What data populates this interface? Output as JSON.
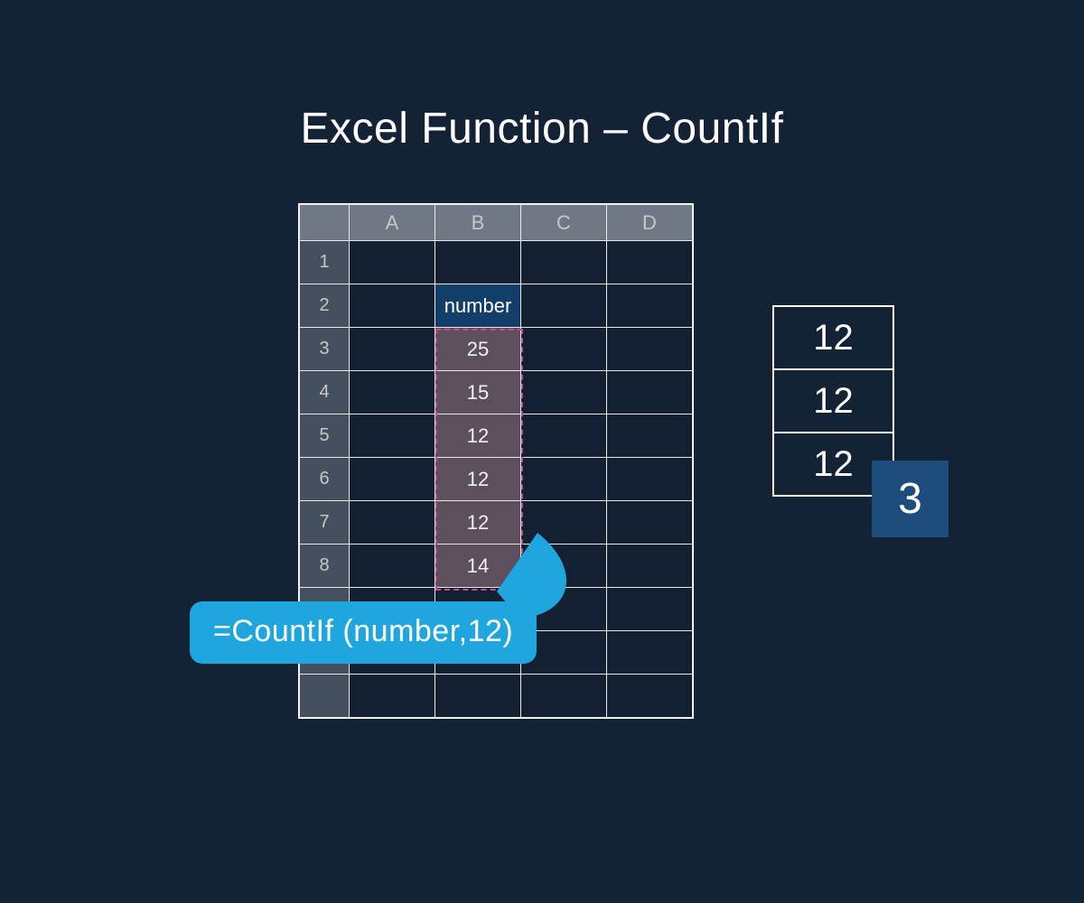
{
  "title": "Excel Function – CountIf",
  "columns": [
    "A",
    "B",
    "C",
    "D"
  ],
  "row_numbers": [
    "1",
    "2",
    "3",
    "4",
    "5",
    "6",
    "7",
    "8",
    "",
    "",
    ""
  ],
  "cells": {
    "B2": "number",
    "B3": "25",
    "B4": "15",
    "B5": "12",
    "B6": "12",
    "B7": "12",
    "B8": "14"
  },
  "highlight_range": "B3:B8",
  "formula": "=CountIf (number,12)",
  "count_illustration": {
    "matches": [
      "12",
      "12",
      "12"
    ],
    "result": "3"
  }
}
